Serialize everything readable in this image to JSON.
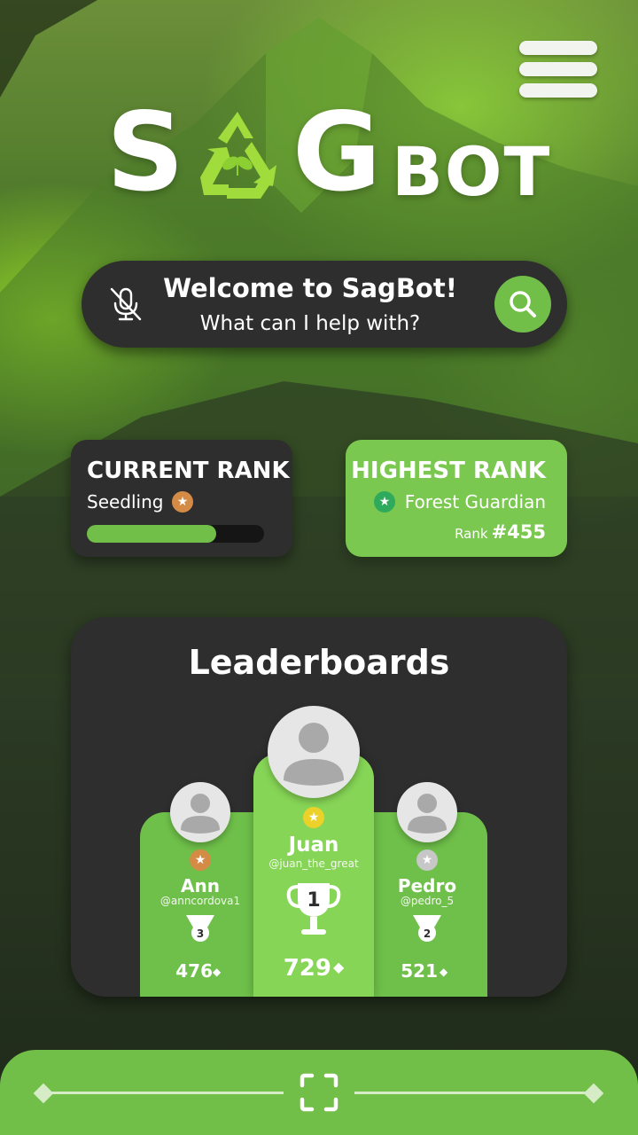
{
  "app": {
    "logo_letters": [
      "S",
      "G"
    ],
    "logo_suffix": "BOT"
  },
  "search": {
    "welcome": "Welcome to SagBot!",
    "prompt": "What can I help with?"
  },
  "current_rank": {
    "title": "CURRENT RANK",
    "level": "Seedling",
    "badge_icon": "star-icon",
    "progress": 0.73
  },
  "highest_rank": {
    "title": "HIGHEST RANK",
    "level": "Forest Guardian",
    "rank_label": "Rank",
    "rank_value": "#455"
  },
  "leaderboard": {
    "title": "Leaderboards",
    "players": [
      {
        "place": 2,
        "name": "Pedro",
        "handle": "@pedro_5",
        "score": "521",
        "medal_color": "#c7c7c7"
      },
      {
        "place": 1,
        "name": "Juan",
        "handle": "@juan_the_great",
        "score": "729",
        "medal_color": "#ecd12a"
      },
      {
        "place": 3,
        "name": "Ann",
        "handle": "@anncordova1",
        "score": "476",
        "medal_color": "#d48b45"
      }
    ],
    "trophy_number": "1",
    "medal_numbers": {
      "second": "2",
      "third": "3"
    }
  },
  "colors": {
    "accent_green": "#71bf48",
    "card_dark": "#2e2e2e",
    "bronze": "#d48b45",
    "gold": "#ecd12a",
    "silver": "#c7c7c7"
  }
}
